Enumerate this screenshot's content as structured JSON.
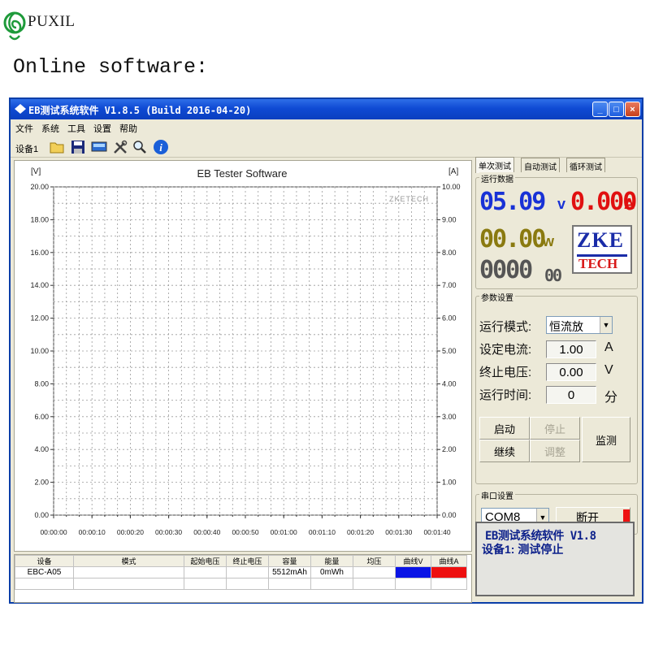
{
  "brand": {
    "name": "PUXIL"
  },
  "caption": "Online software:",
  "window": {
    "title": "EB测试系统软件 V1.8.5 (Build 2016-04-20)",
    "menus": [
      "文件",
      "系统",
      "工具",
      "设置",
      "帮助"
    ],
    "toolbar": {
      "device_label": "设备1",
      "tools": [
        "folder-open-icon",
        "save-icon",
        "monitor-icon",
        "tools-icon",
        "zoom-icon",
        "info-icon"
      ]
    },
    "controls": {
      "minimize": "_",
      "maximize": "□",
      "close": "×"
    }
  },
  "tabs": [
    "单次测试",
    "自动测试",
    "循环测试"
  ],
  "run_data": {
    "label": "运行数据",
    "voltage": "05.09",
    "voltage_unit": "v",
    "current": "0.000",
    "current_unit": "A",
    "power": "00.00",
    "power_unit": "w",
    "time_main": "0000",
    "time_sub": "00",
    "logo_top": "ZKE",
    "logo_bottom": "TECH"
  },
  "params": {
    "label": "参数设置",
    "mode_label": "运行模式:",
    "mode_value": "恒流放",
    "current_label": "设定电流:",
    "current_value": "1.00",
    "current_unit": "A",
    "cutoff_label": "终止电压:",
    "cutoff_value": "0.00",
    "cutoff_unit": "V",
    "time_label": "运行时间:",
    "time_value": "0",
    "time_unit": "分",
    "buttons": {
      "start": "启动",
      "stop": "停止",
      "continue": "继续",
      "adjust": "调整",
      "monitor": "监测"
    }
  },
  "serial": {
    "label": "串口设置",
    "port": "COM8",
    "disconnect": "断开",
    "led_color": "#ee1111"
  },
  "status": {
    "title": "EB测试系统软件 V1.8",
    "line": "设备1: 测试停止"
  },
  "chart_data": {
    "type": "line",
    "title": "EB Tester Software",
    "watermark": "ZKETECH",
    "left_axis": {
      "unit": "[V]",
      "min": 0,
      "max": 20,
      "ticks": [
        "0.00",
        "2.00",
        "4.00",
        "6.00",
        "8.00",
        "10.00",
        "12.00",
        "14.00",
        "16.00",
        "18.00",
        "20.00"
      ]
    },
    "right_axis": {
      "unit": "[A]",
      "min": 0,
      "max": 10,
      "ticks": [
        "0.00",
        "1.00",
        "2.00",
        "3.00",
        "4.00",
        "5.00",
        "6.00",
        "7.00",
        "8.00",
        "9.00",
        "10.00"
      ]
    },
    "x_ticks": [
      "00:00:00",
      "00:00:10",
      "00:00:20",
      "00:00:30",
      "00:00:40",
      "00:00:50",
      "00:01:00",
      "00:01:10",
      "00:01:20",
      "00:01:30",
      "00:01:40"
    ],
    "grid": true,
    "series": []
  },
  "table": {
    "headers": [
      "设备",
      "模式",
      "起始电压",
      "终止电压",
      "容量",
      "能量",
      "均压",
      "曲线V",
      "曲线A"
    ],
    "rows": [
      {
        "device": "EBC-A05",
        "mode": "",
        "start_v": "",
        "end_v": "",
        "capacity": "5512mAh",
        "energy": "0mWh",
        "avg_v": "",
        "curve_v_color": "#0a14e6",
        "curve_a_color": "#ee1010"
      }
    ]
  }
}
